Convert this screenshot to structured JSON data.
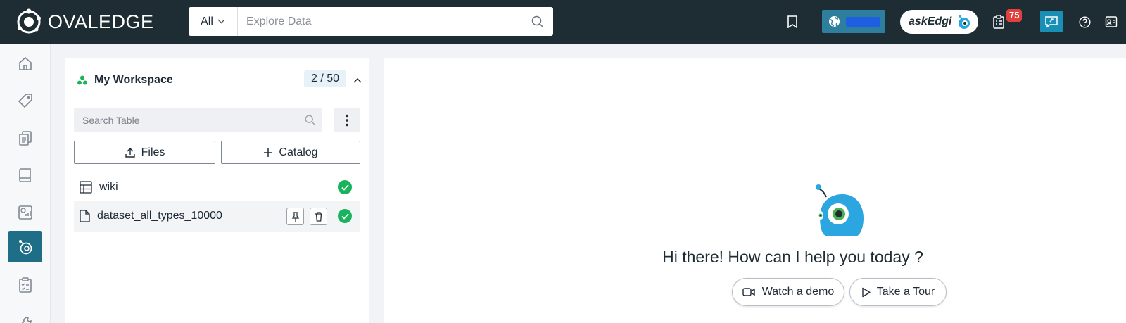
{
  "brand": {
    "name": "OVALEDGE"
  },
  "header": {
    "search": {
      "scope": "All",
      "placeholder": "Explore Data"
    },
    "askedgi_label": "askEdgi",
    "notifications_count": "75"
  },
  "workspace": {
    "title": "My Workspace",
    "count": "2 / 50",
    "table_search_placeholder": "Search Table",
    "files_button": "Files",
    "catalog_button": "Catalog",
    "items": [
      {
        "label": "wiki",
        "type": "table",
        "status": "ready"
      },
      {
        "label": "dataset_all_types_10000",
        "type": "file",
        "status": "ready"
      }
    ]
  },
  "main": {
    "greeting": "Hi there! How can I help you today ?",
    "watch_demo": "Watch a demo",
    "take_tour": "Take a Tour"
  },
  "rail": {
    "items": [
      {
        "icon": "home-icon"
      },
      {
        "icon": "tag-icon"
      },
      {
        "icon": "documents-icon"
      },
      {
        "icon": "book-icon"
      },
      {
        "icon": "analytics-icon"
      },
      {
        "icon": "askedgi-bot-icon",
        "active": true
      },
      {
        "icon": "tasks-icon"
      },
      {
        "icon": "tools-icon"
      }
    ]
  },
  "colors": {
    "topbar": "#1e2d33",
    "accent": "#1f6e87",
    "success": "#19b35c",
    "badge": "#e0413c"
  }
}
